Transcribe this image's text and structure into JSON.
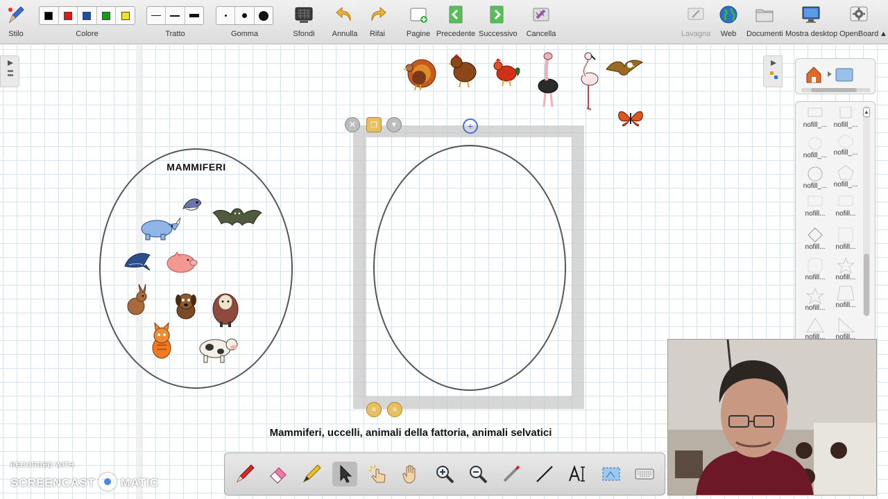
{
  "toolbar": {
    "stylus": "Stilo",
    "color": "Colore",
    "line": "Tratto",
    "eraser": "Gomma",
    "backgrounds": "Sfondi",
    "undo": "Annulla",
    "redo": "Rifai",
    "pages": "Pagine",
    "previous": "Precedente",
    "next": "Successivo",
    "clear": "Cancella",
    "board": "Lavagna",
    "web": "Web",
    "documents": "Documenti",
    "desktop": "Mostra desktop",
    "openboard": "OpenBoard"
  },
  "colors": [
    "#000000",
    "#e01818",
    "#1c4fa8",
    "#179a1a",
    "#f2e21a"
  ],
  "board": {
    "mammal_title": "MAMMIFERI",
    "caption": "Mammiferi, uccelli, animali della fattoria, animali selvatici"
  },
  "library": {
    "items": [
      "nofill_...",
      "nofill_...",
      "nofill_...",
      "nofill_...",
      "nofill_...",
      "nofill_...",
      "nofill...",
      "nofill...",
      "nofill...",
      "nofill...",
      "nofill...",
      "nofill...",
      "nofill...",
      "nofill...",
      "nofill...",
      "nofill..."
    ]
  },
  "watermark": {
    "small": "RECORDED WITH",
    "brand_left": "SCREENCAST",
    "brand_right": "MATIC"
  },
  "icons": {
    "bottom_tools": [
      "pen-icon",
      "eraser-icon",
      "marker-icon",
      "pointer-icon",
      "interact-icon",
      "hand-icon",
      "zoom-in-icon",
      "zoom-out-icon",
      "laser-icon",
      "line-icon",
      "text-icon",
      "capture-icon",
      "keyboard-icon"
    ]
  },
  "accent": "#4a6fd4"
}
